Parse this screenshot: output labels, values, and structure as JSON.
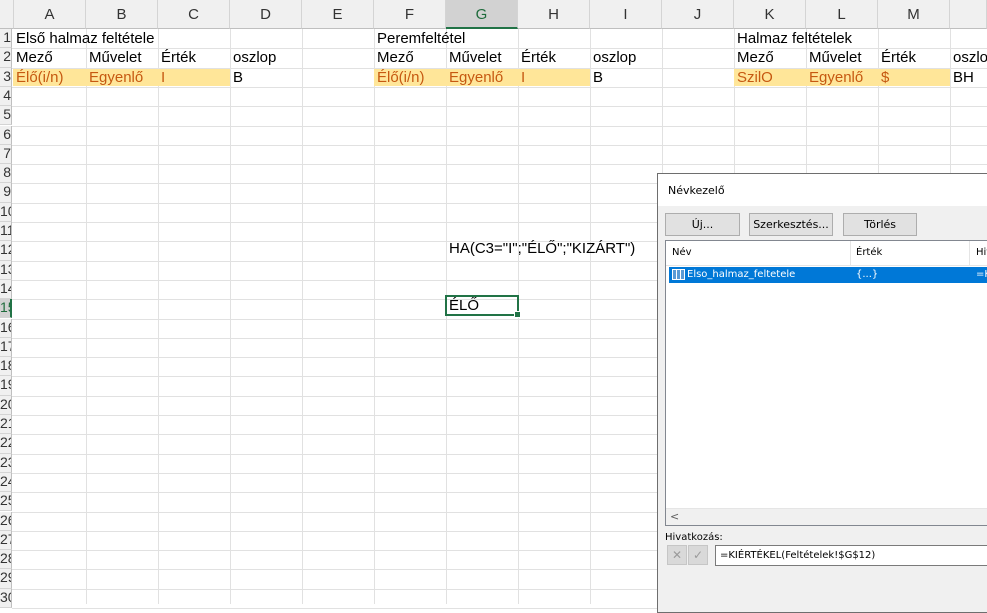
{
  "columns": [
    "A",
    "B",
    "C",
    "D",
    "E",
    "F",
    "G",
    "H",
    "I",
    "J",
    "K",
    "L",
    "M"
  ],
  "rows": [
    "1",
    "2",
    "3",
    "4",
    "5",
    "6",
    "7",
    "8",
    "9",
    "10",
    "11",
    "12",
    "13",
    "14",
    "15",
    "16",
    "17",
    "18",
    "19",
    "20",
    "21",
    "22",
    "23",
    "24",
    "25",
    "26",
    "27",
    "28",
    "29",
    "30"
  ],
  "selected_column": "G",
  "selected_row": "15",
  "cells": {
    "A1": "Első halmaz feltétele",
    "A2": "Mező",
    "B2": "Művelet",
    "C2": "Érték",
    "D2": "oszlop",
    "A3": "Élő(i/n)",
    "B3": "Egyenlő",
    "C3": "I",
    "D3": "B",
    "F1": "Peremfeltétel",
    "F2": "Mező",
    "G2": "Művelet",
    "H2": "Érték",
    "I2": "oszlop",
    "F3": "Élő(i/n)",
    "G3": "Egyenlő",
    "H3": "I",
    "I3": "B",
    "K1": "Halmaz feltételek",
    "K2": "Mező",
    "L2": "Művelet",
    "M2": "Érték",
    "N2": "oszlo",
    "K3": "SzilO",
    "L3": "Egyenlő",
    "M3": "$",
    "N3": "BH",
    "G12": "HA(C3=\"I\";\"ÉLŐ\";\"KIZÁRT\")",
    "G15": "ÉLŐ"
  },
  "highlight_color": "#ffe699",
  "dialog": {
    "title": "Névkezelő",
    "buttons": {
      "new": "Új...",
      "edit": "Szerkesztés...",
      "delete": "Törlés"
    },
    "list_headers": {
      "name": "Név",
      "value": "Érték",
      "refers": "Hiv"
    },
    "rows": [
      {
        "name": "Elso_halmaz_feltetele",
        "value": "{...}",
        "refers": "=K"
      }
    ],
    "reference_label": "Hivatkozás:",
    "reference_value": "=KIÉRTÉKEL(Feltételek!$G$12)",
    "cancel_icon": "x-icon",
    "confirm_icon": "check-icon"
  }
}
